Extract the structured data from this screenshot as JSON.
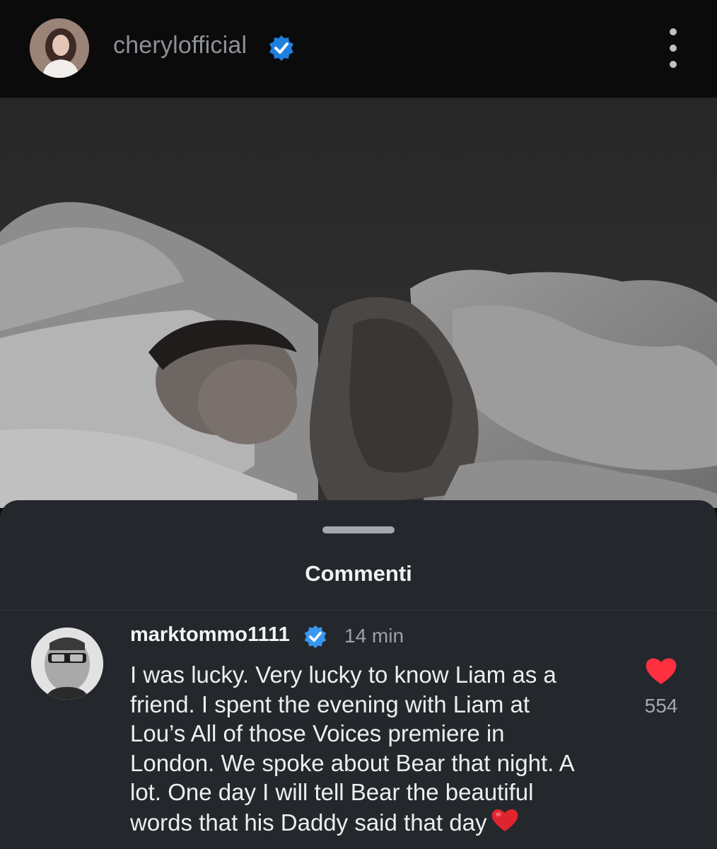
{
  "post": {
    "username": "cherylofficial",
    "avatar_icon": "profile-avatar",
    "verified_icon": "verified-badge-icon",
    "more_icon": "more-options-icon"
  },
  "photo": {
    "icon": "post-photo-black-and-white"
  },
  "comments_sheet": {
    "title": "Commenti"
  },
  "comment": {
    "username": "marktommo1111",
    "time": "14 min",
    "text": "I was lucky. Very lucky to know Liam as a\nfriend. I spent the evening with Liam at\nLou’s All of those Voices premiere in\nLondon. We spoke about Bear that night. A\nlot. One day I will tell Bear the beautiful\nwords that his Daddy said that day",
    "likes": "554",
    "heart_color": "#ff3040",
    "verified_color": "#3897f0"
  }
}
